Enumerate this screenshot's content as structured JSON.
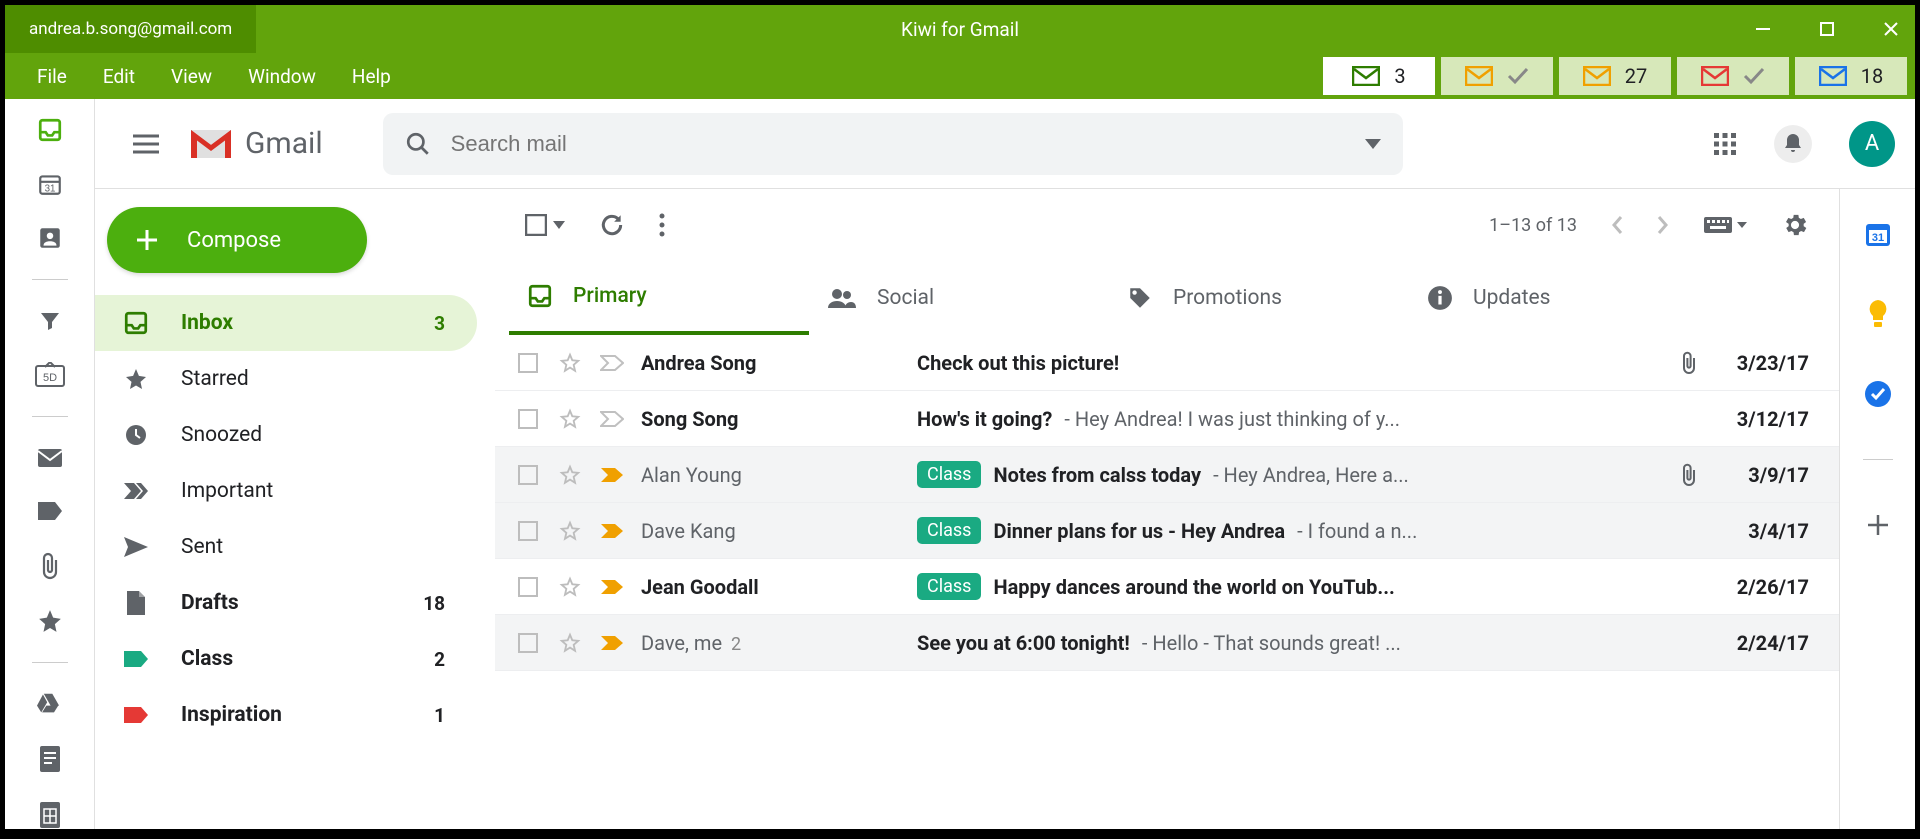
{
  "titlebar": {
    "account_email": "andrea.b.song@gmail.com",
    "app_title": "Kiwi for Gmail"
  },
  "menus": [
    "File",
    "Edit",
    "View",
    "Window",
    "Help"
  ],
  "account_pills": [
    {
      "color": "#2e7d00",
      "count": "3",
      "check": false,
      "active": true
    },
    {
      "color": "#f0a000",
      "count": "",
      "check": true,
      "active": false
    },
    {
      "color": "#f0a000",
      "count": "27",
      "check": false,
      "active": false
    },
    {
      "color": "#e53935",
      "count": "",
      "check": true,
      "active": false
    },
    {
      "color": "#1a73e8",
      "count": "18",
      "check": false,
      "active": false
    }
  ],
  "header": {
    "product": "Gmail",
    "search_placeholder": "Search mail",
    "avatar_letter": "A"
  },
  "compose_label": "Compose",
  "nav": [
    {
      "icon": "inbox",
      "label": "Inbox",
      "count": "3",
      "active": true,
      "bold": true,
      "color": "#2e7d00"
    },
    {
      "icon": "star",
      "label": "Starred",
      "count": "",
      "active": false,
      "bold": false,
      "color": "#5f6368"
    },
    {
      "icon": "clock",
      "label": "Snoozed",
      "count": "",
      "active": false,
      "bold": false,
      "color": "#5f6368"
    },
    {
      "icon": "important",
      "label": "Important",
      "count": "",
      "active": false,
      "bold": false,
      "color": "#5f6368"
    },
    {
      "icon": "send",
      "label": "Sent",
      "count": "",
      "active": false,
      "bold": false,
      "color": "#5f6368"
    },
    {
      "icon": "draft",
      "label": "Drafts",
      "count": "18",
      "active": false,
      "bold": true,
      "color": "#5f6368"
    },
    {
      "icon": "tag",
      "label": "Class",
      "count": "2",
      "active": false,
      "bold": true,
      "color": "#1aaa82"
    },
    {
      "icon": "tag",
      "label": "Inspiration",
      "count": "1",
      "active": false,
      "bold": true,
      "color": "#e53935"
    }
  ],
  "toolbar": {
    "range": "1–13 of 13"
  },
  "tabs": [
    {
      "icon": "inbox",
      "label": "Primary",
      "active": true
    },
    {
      "icon": "people",
      "label": "Social",
      "active": false
    },
    {
      "icon": "tag",
      "label": "Promotions",
      "active": false
    },
    {
      "icon": "info",
      "label": "Updates",
      "active": false
    }
  ],
  "rows": [
    {
      "from": "Andrea Song",
      "from_count": "",
      "label": "",
      "subject": "Check out this picture!",
      "preview": "",
      "attachment": true,
      "date": "3/23/17",
      "important_color": "",
      "read": false
    },
    {
      "from": "Song Song",
      "from_count": "",
      "label": "",
      "subject": "How's it going?",
      "preview": " - Hey Andrea! I was just thinking of y...",
      "attachment": false,
      "date": "3/12/17",
      "important_color": "",
      "read": false
    },
    {
      "from": "Alan Young",
      "from_count": "",
      "label": "Class",
      "subject": "Notes from calss today",
      "preview": " - Hey Andrea, Here a...",
      "attachment": true,
      "date": "3/9/17",
      "important_color": "#f0a000",
      "read": true
    },
    {
      "from": "Dave Kang",
      "from_count": "",
      "label": "Class",
      "subject": "Dinner plans for us - Hey Andrea",
      "preview": " - I found a n...",
      "attachment": false,
      "date": "3/4/17",
      "important_color": "#f0a000",
      "read": true
    },
    {
      "from": "Jean Goodall",
      "from_count": "",
      "label": "Class",
      "subject": "Happy dances around the world on YouTub...",
      "preview": "",
      "attachment": false,
      "date": "2/26/17",
      "important_color": "#f0a000",
      "read": false
    },
    {
      "from": "Dave, me",
      "from_count": "2",
      "label": "",
      "subject": "See you at 6:00 tonight!",
      "preview": " - Hello - That sounds great! ...",
      "attachment": false,
      "date": "2/24/17",
      "important_color": "#f0a000",
      "read": true
    }
  ]
}
